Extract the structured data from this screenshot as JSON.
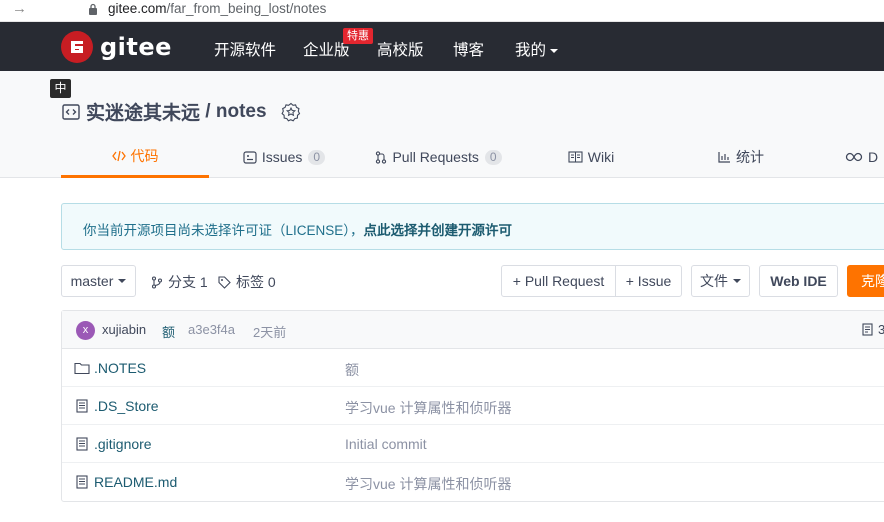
{
  "browser": {
    "back_glyph": "→",
    "url_domain": "gitee.com",
    "url_path": "/far_from_being_lost/notes"
  },
  "topnav": {
    "logo_letter": "G",
    "logo_text": "gitee",
    "items": [
      "开源软件",
      "企业版",
      "高校版",
      "博客",
      "我的"
    ],
    "hot_badge": "特惠"
  },
  "repo": {
    "lang_tip": "中",
    "owner": "实迷途其未远",
    "separator": " / ",
    "name": "notes"
  },
  "tabs": [
    {
      "label": "代码",
      "icon": "code-icon",
      "active": true
    },
    {
      "label": "Issues",
      "count": "0",
      "icon": "issues-icon"
    },
    {
      "label": "Pull Requests",
      "count": "0",
      "icon": "pull-request-icon"
    },
    {
      "label": "Wiki",
      "icon": "wiki-icon"
    },
    {
      "label": "统计",
      "icon": "stats-icon"
    },
    {
      "label": "D",
      "icon": "devops-icon"
    }
  ],
  "notice": {
    "text": "你当前开源项目尚未选择许可证（LICENSE），",
    "link": "点此选择并创建开源许可"
  },
  "toolbar": {
    "branch": "master",
    "branches": "分支 1",
    "tags": "标签 0",
    "pull_request": "+ Pull Request",
    "issue": "+ Issue",
    "file": "文件",
    "web_ide": "Web IDE",
    "clone": "克隆"
  },
  "commit": {
    "avatar": "x",
    "user": "xujiabin",
    "message": "额",
    "sha": "a3e3f4a",
    "time": "2天前",
    "count": "3"
  },
  "files": [
    {
      "name": ".NOTES",
      "message": "额",
      "type": "folder"
    },
    {
      "name": ".DS_Store",
      "message": "学习vue 计算属性和侦听器",
      "type": "file"
    },
    {
      "name": ".gitignore",
      "message": "Initial commit",
      "type": "file"
    },
    {
      "name": "README.md",
      "message": "学习vue 计算属性和侦听器",
      "type": "file"
    }
  ],
  "colors": {
    "nav_bg": "#282b33",
    "brand_red": "#c71d23",
    "accent_orange": "#fe7300",
    "link_blue": "#1c5b70"
  }
}
